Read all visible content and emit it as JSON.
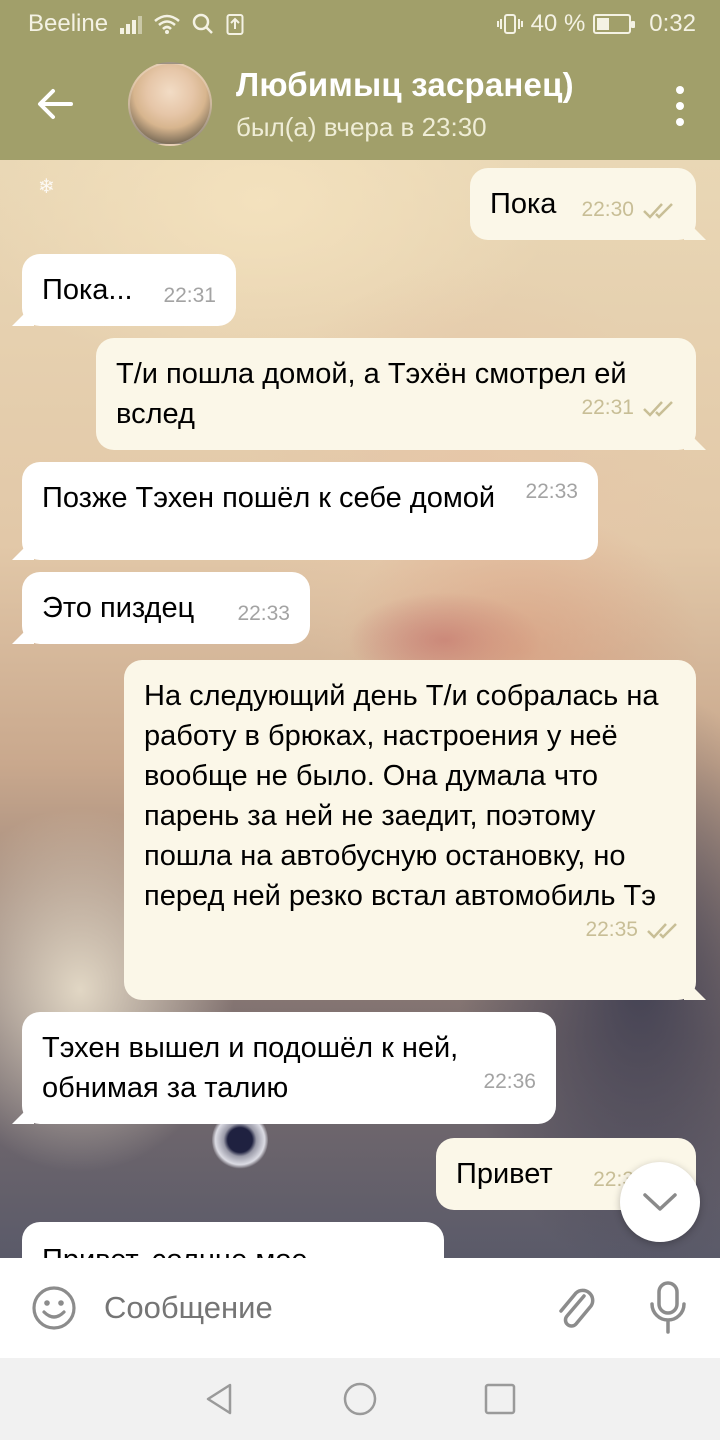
{
  "status_bar": {
    "carrier": "Beeline",
    "battery_text": "40 %",
    "battery_level": 0.4,
    "time": "0:32"
  },
  "header": {
    "title": "Любимыц засранец)",
    "subtitle": "был(а) вчера в 23:30"
  },
  "messages": [
    {
      "dir": "out",
      "text": "Пока",
      "time": "22:30",
      "read": true
    },
    {
      "dir": "in",
      "text": "Пока...",
      "time": "22:31"
    },
    {
      "dir": "out",
      "text": "Т/и пошла домой, а Тэхён смотрел ей вслед",
      "time": "22:31",
      "read": true
    },
    {
      "dir": "in",
      "text": "Позже Тэхен пошёл к себе домой",
      "time": "22:33"
    },
    {
      "dir": "in",
      "text": "Это пиздец",
      "time": "22:33"
    },
    {
      "dir": "out",
      "text": "На следующий день Т/и собралась на работу в брюках, настроения у неё вообще не было. Она думала что парень за ней не заедит, поэтому пошла на автобусную остановку, но перед ней резко встал автомобиль Тэ",
      "time": "22:35",
      "read": true
    },
    {
      "dir": "in",
      "text": "Тэхен вышел и подошёл к ней, обнимая за талию",
      "time": "22:36"
    },
    {
      "dir": "out",
      "text": "Привет",
      "time": "22:3",
      "read": true
    },
    {
      "dir": "in",
      "text": "Привет, солнце мое",
      "time": ""
    }
  ],
  "composer": {
    "placeholder": "Сообщение"
  },
  "icons": {
    "back": "arrow-left-icon",
    "menu": "more-vert-icon",
    "emoji": "smiley-icon",
    "attach": "paperclip-icon",
    "mic": "microphone-icon",
    "scroll_down": "chevron-down-icon"
  },
  "colors": {
    "header": "#a19f6a",
    "outgoing_bubble": "#fbf7e8",
    "incoming_bubble": "#ffffff",
    "read_check": "#c8be96"
  }
}
